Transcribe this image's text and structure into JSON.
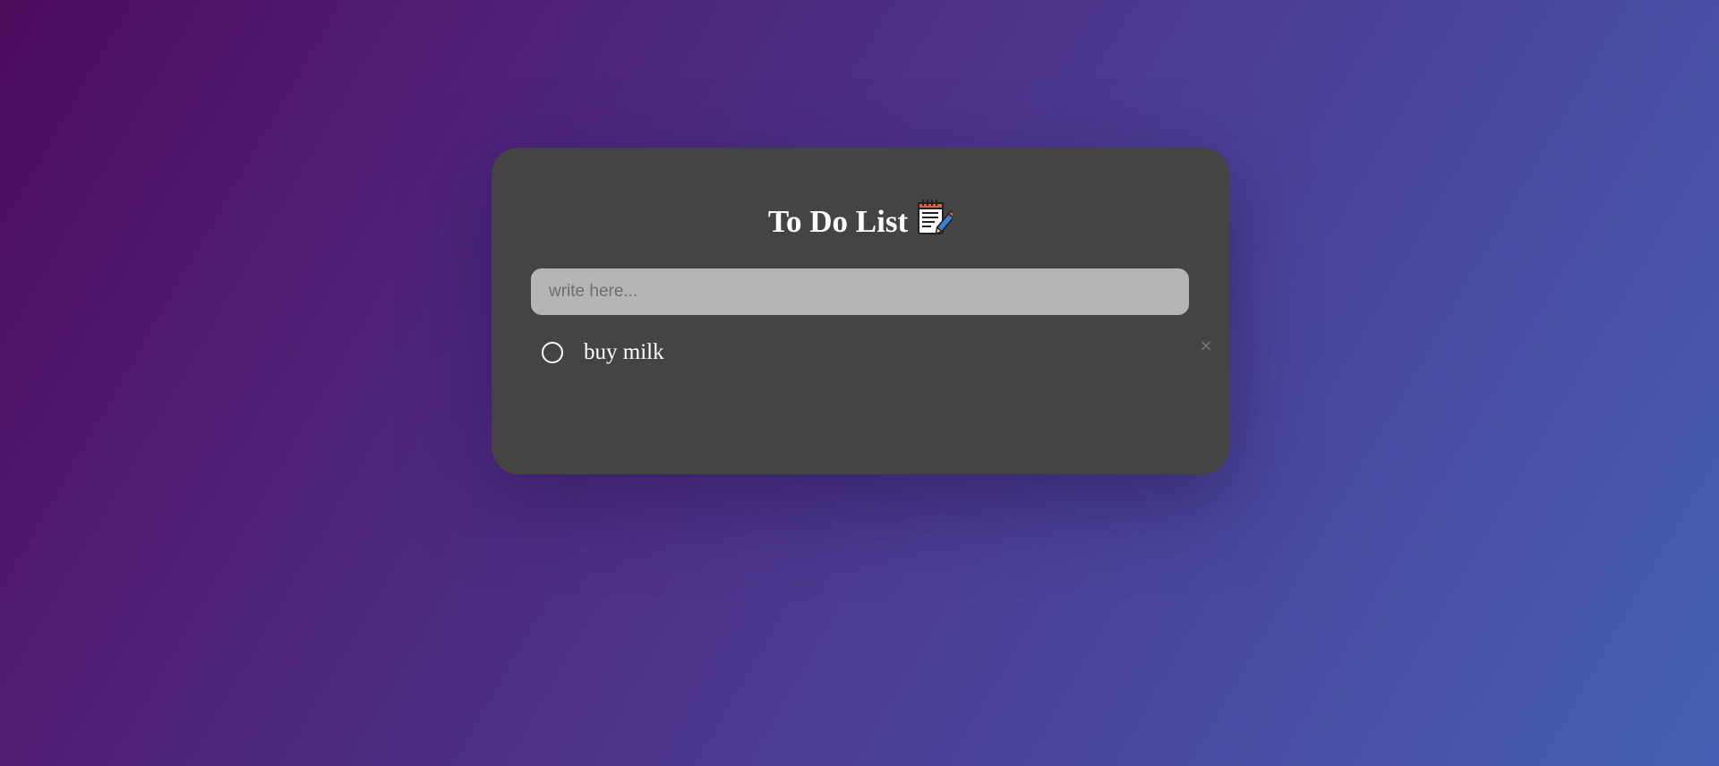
{
  "app": {
    "title": "To Do List",
    "title_icon": "notepad-icon"
  },
  "input": {
    "placeholder": "write here...",
    "value": ""
  },
  "todos": [
    {
      "text": "buy milk",
      "completed": false,
      "delete_label": "×"
    }
  ],
  "colors": {
    "card_background": "#444444",
    "input_background": "#b5b5b5",
    "gradient_start": "#4e0b5e",
    "gradient_end": "#465fb3"
  }
}
